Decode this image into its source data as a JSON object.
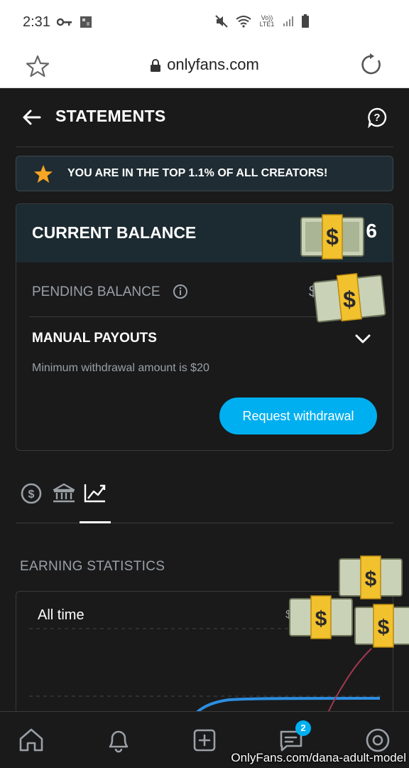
{
  "status_bar": {
    "time": "2:31",
    "icons": [
      "key-icon",
      "gallery-icon",
      "mute-icon",
      "wifi-icon",
      "volte-icon",
      "signal-icon",
      "battery-icon"
    ],
    "volte_text": "Vo)) LTE1"
  },
  "browser": {
    "url": "onlyfans.com",
    "icons": [
      "star-icon",
      "lock-icon",
      "reload-icon"
    ]
  },
  "header": {
    "title": "STATEMENTS",
    "icons": [
      "back-arrow-icon",
      "help-icon"
    ]
  },
  "banner": {
    "text": "YOU ARE IN THE TOP 1.1% OF ALL CREATORS!",
    "icon": "star-icon",
    "icon_color": "#f5a623"
  },
  "balance": {
    "current_label": "CURRENT BALANCE",
    "current_value_prefix": "$",
    "current_value_suffix": "6",
    "pending_label": "PENDING BALANCE",
    "pending_value_prefix": "$",
    "payouts_label": "MANUAL PAYOUTS",
    "min_text": "Minimum withdrawal amount is $20",
    "withdraw_button": "Request withdrawal"
  },
  "tabs": [
    {
      "icon": "dollar-circle-icon",
      "active": false
    },
    {
      "icon": "bank-icon",
      "active": false
    },
    {
      "icon": "chart-line-icon",
      "active": true
    }
  ],
  "stats": {
    "title": "EARNING STATISTICS",
    "range_label": "All time",
    "range_value_prefix": "$"
  },
  "bottom_nav": {
    "items": [
      "home-icon",
      "bell-icon",
      "add-icon",
      "messages-icon",
      "profile-icon"
    ],
    "messages_badge": "2"
  },
  "watermark": "OnlyFans.com/dana-adult-model",
  "colors": {
    "accent": "#00aff0",
    "background": "#1a1a1b",
    "line_blue": "#2c8ee0",
    "line_red": "#a0394f"
  }
}
